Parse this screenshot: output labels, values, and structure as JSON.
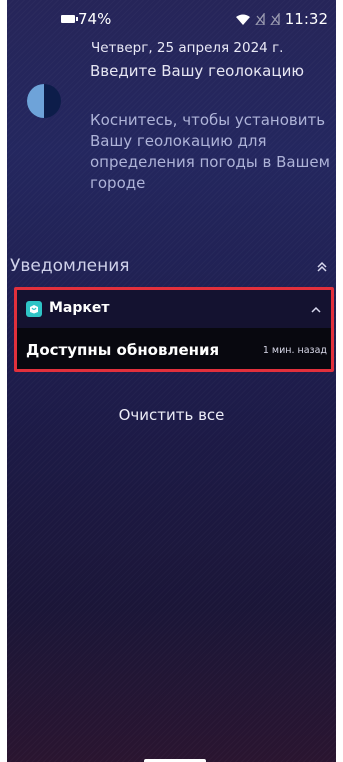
{
  "status_bar": {
    "battery_percent": "74%",
    "time": "11:32",
    "icons": [
      "battery-icon",
      "wifi-icon",
      "sim-no-signal-icon",
      "sim-no-signal-icon"
    ]
  },
  "lockscreen": {
    "date": "Четверг, 25 апреля 2024 г.",
    "weather": {
      "icon": "weather-half-moon-icon",
      "title": "Введите Вашу геолокацию",
      "description": "Коснитесь, чтобы установить Вашу геолокацию для определения погоды в Вашем городе"
    }
  },
  "notifications": {
    "header": "Уведомления",
    "collapse_icon": "double-chevron-up-icon",
    "items": [
      {
        "app_icon": "market-app-icon",
        "app_name": "Маркет",
        "expand_icon": "chevron-up-icon",
        "title": "Доступны обновления",
        "time": "1 мин. назад",
        "highlight_color": "#e2303c"
      }
    ],
    "clear_all": "Очистить все"
  }
}
